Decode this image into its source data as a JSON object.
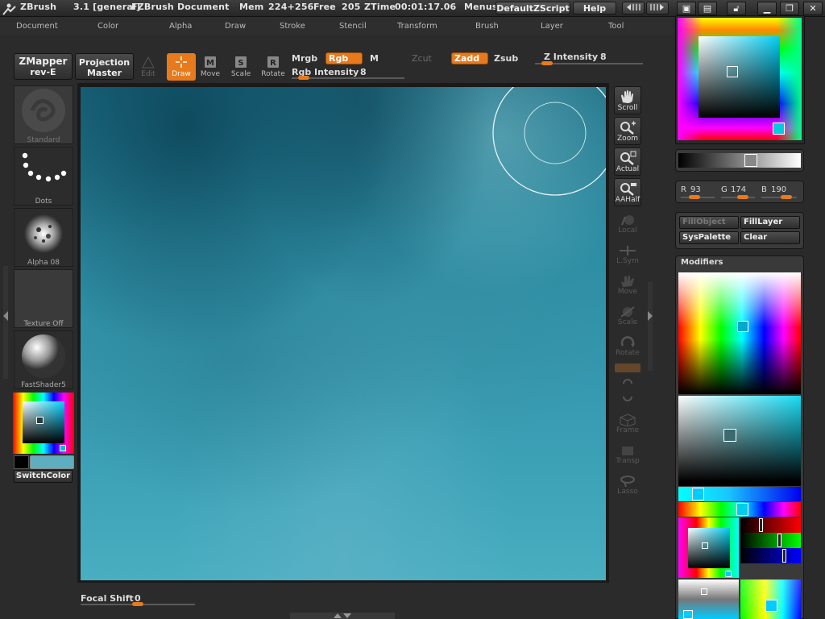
{
  "app": {
    "name": "ZBrush",
    "version": "3.1 [general]",
    "document": "FZBrush Document",
    "mem_label": "Mem",
    "mem_value": "224+256",
    "free_label": "Free",
    "free_value": "205",
    "ztime_label": "ZTime",
    "ztime_value": "00:01:17.06",
    "menus_label": "Menus",
    "script_label": "DefaultZScript",
    "help_label": "Help"
  },
  "menu": [
    "Document",
    "Color",
    "Alpha",
    "Draw",
    "Stroke",
    "Stencil",
    "Transform",
    "Brush",
    "Layer",
    "Tool"
  ],
  "toolbar": {
    "zmapper_line1": "ZMapper",
    "zmapper_line2": "rev-E",
    "projection_line1": "Projection",
    "projection_line2": "Master",
    "edit": "Edit",
    "draw": "Draw",
    "move": "Move",
    "scale": "Scale",
    "rotate": "Rotate",
    "mrgb": "Mrgb",
    "rgb": "Rgb",
    "m": "M",
    "zcut": "Zcut",
    "zadd": "Zadd",
    "zsub": "Zsub",
    "z_intensity_label": "Z Intensity",
    "z_intensity_value": "8",
    "z_intensity_level": 0.06,
    "rgb_intensity_label": "Rgb Intensity",
    "rgb_intensity_value": "8",
    "rgb_intensity_level": 0.06
  },
  "shelf": {
    "standard": "Standard",
    "dots": "Dots",
    "alpha": "Alpha 08",
    "texture": "Texture Off",
    "material": "FastShader5",
    "switch_color": "SwitchColor"
  },
  "right_tools": {
    "scroll": "Scroll",
    "zoom": "Zoom",
    "actual": "Actual",
    "aahalf": "AAHalf",
    "local": "Local",
    "lsym": "L.Sym",
    "move": "Move",
    "scale": "Scale",
    "rotate": "Rotate",
    "frame": "Frame",
    "transp": "Transp",
    "lasso": "Lasso"
  },
  "color": {
    "r_label": "R",
    "r_value": "93",
    "g_label": "G",
    "g_value": "174",
    "b_label": "B",
    "b_value": "190",
    "swatch": "#5daebe",
    "accent": "#e77a1c"
  },
  "panel": {
    "fill_object": "FillObject",
    "fill_layer": "FillLayer",
    "sys_palette": "SysPalette",
    "clear": "Clear",
    "modifiers": "Modifiers"
  },
  "focal": {
    "label": "Focal Shift",
    "value": "0"
  }
}
